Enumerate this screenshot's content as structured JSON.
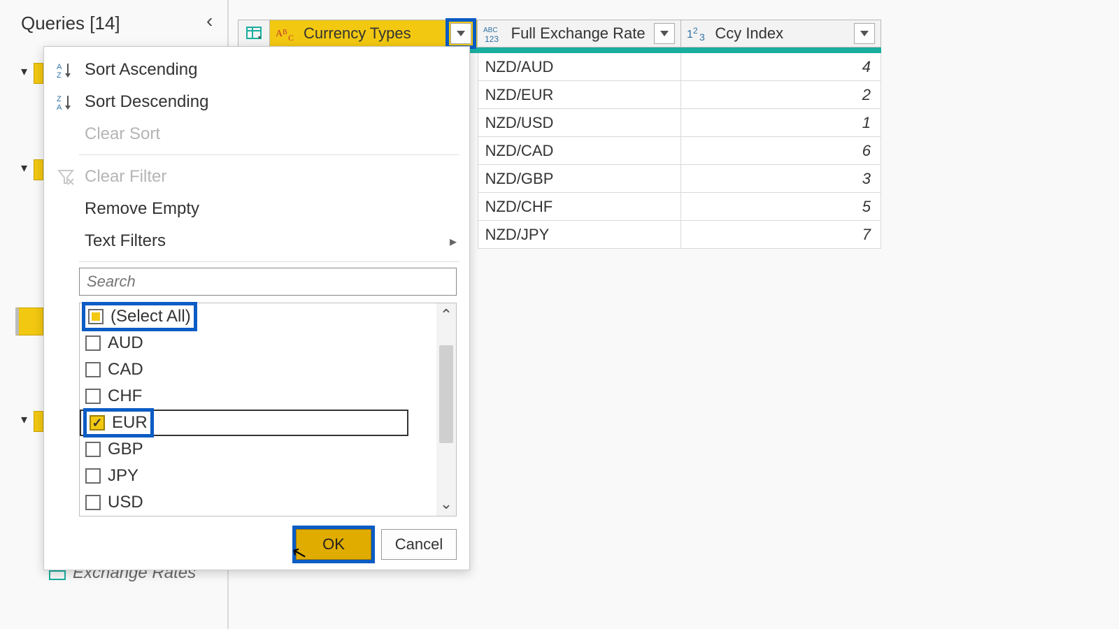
{
  "queries_header": "Queries [14]",
  "bottom_query_name": "Exchange Rates",
  "columns": {
    "currency": "Currency Types",
    "rate": "Full Exchange Rate",
    "idx": "Ccy Index"
  },
  "rows": [
    {
      "rate": "NZD/AUD",
      "idx": "4"
    },
    {
      "rate": "NZD/EUR",
      "idx": "2"
    },
    {
      "rate": "NZD/USD",
      "idx": "1"
    },
    {
      "rate": "NZD/CAD",
      "idx": "6"
    },
    {
      "rate": "NZD/GBP",
      "idx": "3"
    },
    {
      "rate": "NZD/CHF",
      "idx": "5"
    },
    {
      "rate": "NZD/JPY",
      "idx": "7"
    }
  ],
  "dropdown": {
    "sort_asc": "Sort Ascending",
    "sort_desc": "Sort Descending",
    "clear_sort": "Clear Sort",
    "clear_filter": "Clear Filter",
    "remove_empty": "Remove Empty",
    "text_filters": "Text Filters",
    "search_placeholder": "Search",
    "values": [
      {
        "label": "(Select All)",
        "state": "indeterminate"
      },
      {
        "label": "AUD",
        "state": "unchecked"
      },
      {
        "label": "CAD",
        "state": "unchecked"
      },
      {
        "label": "CHF",
        "state": "unchecked"
      },
      {
        "label": "EUR",
        "state": "checked"
      },
      {
        "label": "GBP",
        "state": "unchecked"
      },
      {
        "label": "JPY",
        "state": "unchecked"
      },
      {
        "label": "USD",
        "state": "unchecked"
      }
    ],
    "ok": "OK",
    "cancel": "Cancel"
  }
}
